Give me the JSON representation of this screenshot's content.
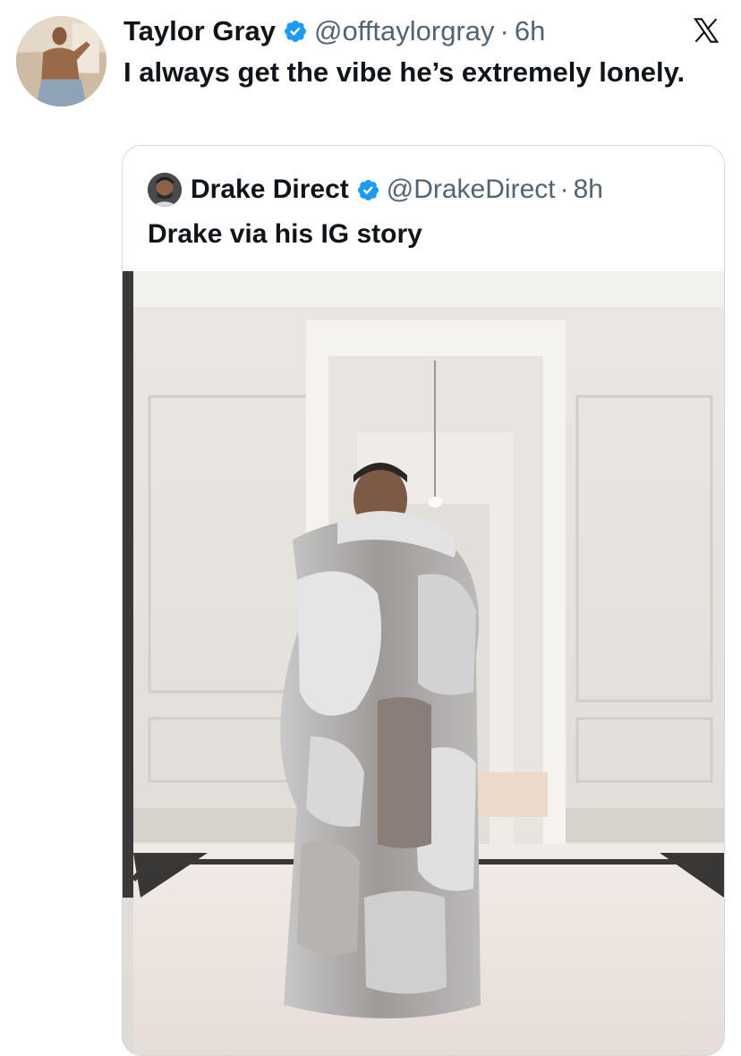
{
  "tweet": {
    "author_name": "Taylor Gray",
    "author_handle": "@offtaylorgray",
    "separator": "·",
    "time": "6h",
    "text": "I always get the vibe he’s extremely lonely.",
    "avatar_icon": "profile-photo",
    "verified_icon": "verified-badge-icon"
  },
  "logo_icon": "x-logo-icon",
  "quoted": {
    "author_name": "Drake Direct",
    "author_handle": "@DrakeDirect",
    "separator": "·",
    "time": "8h",
    "text": "Drake via his IG story",
    "avatar_icon": "profile-photo",
    "verified_icon": "verified-badge-icon",
    "media": "photo"
  },
  "colors": {
    "verified_blue": "#1d9bf0",
    "text_primary": "#0f1419",
    "text_secondary": "#536471",
    "border": "#cfd9de"
  }
}
